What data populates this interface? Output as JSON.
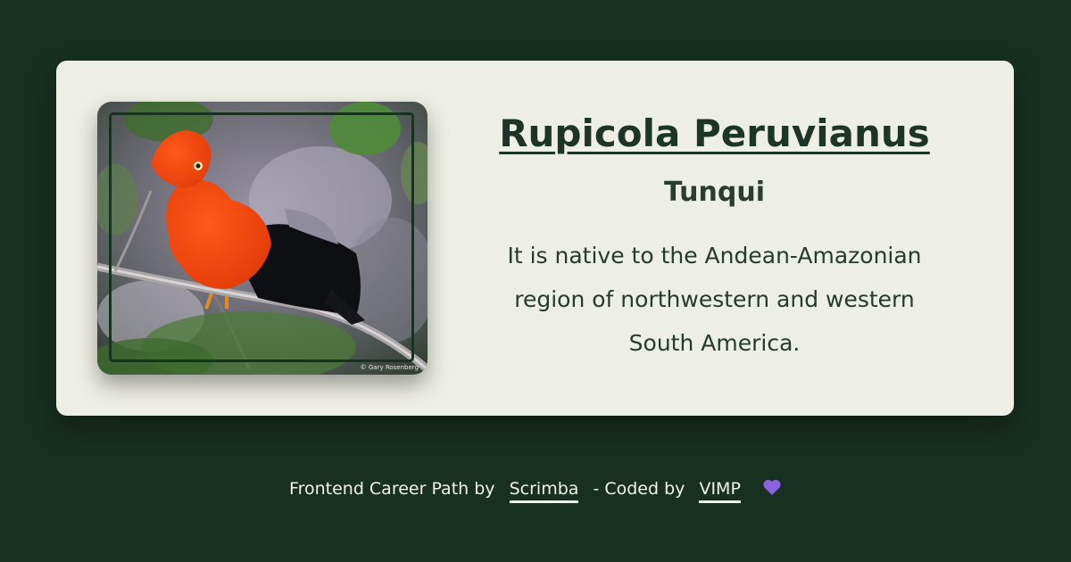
{
  "card": {
    "title": "Rupicola Peruvianus",
    "subtitle": "Tunqui",
    "description": "It is native to the Andean-Amazonian region of northwestern and western South America.",
    "photo_credit": "© Gary Rosenberg"
  },
  "footer": {
    "prefix": "Frontend Career Path by",
    "scrimba_link": "Scrimba",
    "middle": "- Coded by",
    "author_link": "VIMP",
    "heart_icon": "purple-heart-icon"
  },
  "colors": {
    "background": "#173020",
    "card": "#eeefe4",
    "text": "#1d3526",
    "heart": "#8b63e0"
  }
}
